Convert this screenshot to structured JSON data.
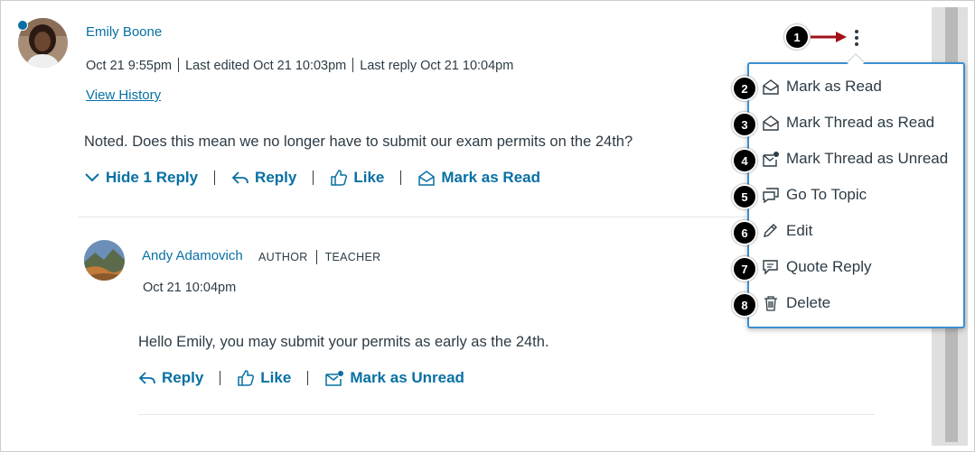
{
  "post": {
    "author": "Emily Boone",
    "timestamp": "Oct 21 9:55pm",
    "last_edited": "Last edited Oct 21 10:03pm",
    "last_reply": "Last reply Oct 21 10:04pm",
    "view_history": "View History",
    "message": "Noted. Does this mean we no longer have to submit our exam permits on the 24th?",
    "actions": {
      "hide_replies": "Hide 1 Reply",
      "reply": "Reply",
      "like": "Like",
      "mark_read": "Mark as Read"
    }
  },
  "reply": {
    "author": "Andy Adamovich",
    "role_author": "AUTHOR",
    "role_teacher": "TEACHER",
    "timestamp": "Oct 21 10:04pm",
    "message": "Hello Emily, you may submit your permits as early as the 24th.",
    "actions": {
      "reply": "Reply",
      "like": "Like",
      "mark_unread": "Mark as Unread"
    }
  },
  "menu": {
    "items": [
      {
        "label": "Mark as Read",
        "icon": "envelope-open-icon"
      },
      {
        "label": "Mark Thread as Read",
        "icon": "envelope-open-icon"
      },
      {
        "label": "Mark Thread as Unread",
        "icon": "envelope-unread-icon"
      },
      {
        "label": "Go To Topic",
        "icon": "discussion-icon"
      },
      {
        "label": "Edit",
        "icon": "pencil-icon"
      },
      {
        "label": "Quote Reply",
        "icon": "quote-icon"
      },
      {
        "label": "Delete",
        "icon": "trash-icon"
      }
    ]
  },
  "callouts": [
    "1",
    "2",
    "3",
    "4",
    "5",
    "6",
    "7",
    "8"
  ],
  "colors": {
    "link": "#0770a3",
    "text": "#2d3b45",
    "menu_border": "#3c8fd0",
    "arrow": "#a01217",
    "callout": "#000000"
  }
}
